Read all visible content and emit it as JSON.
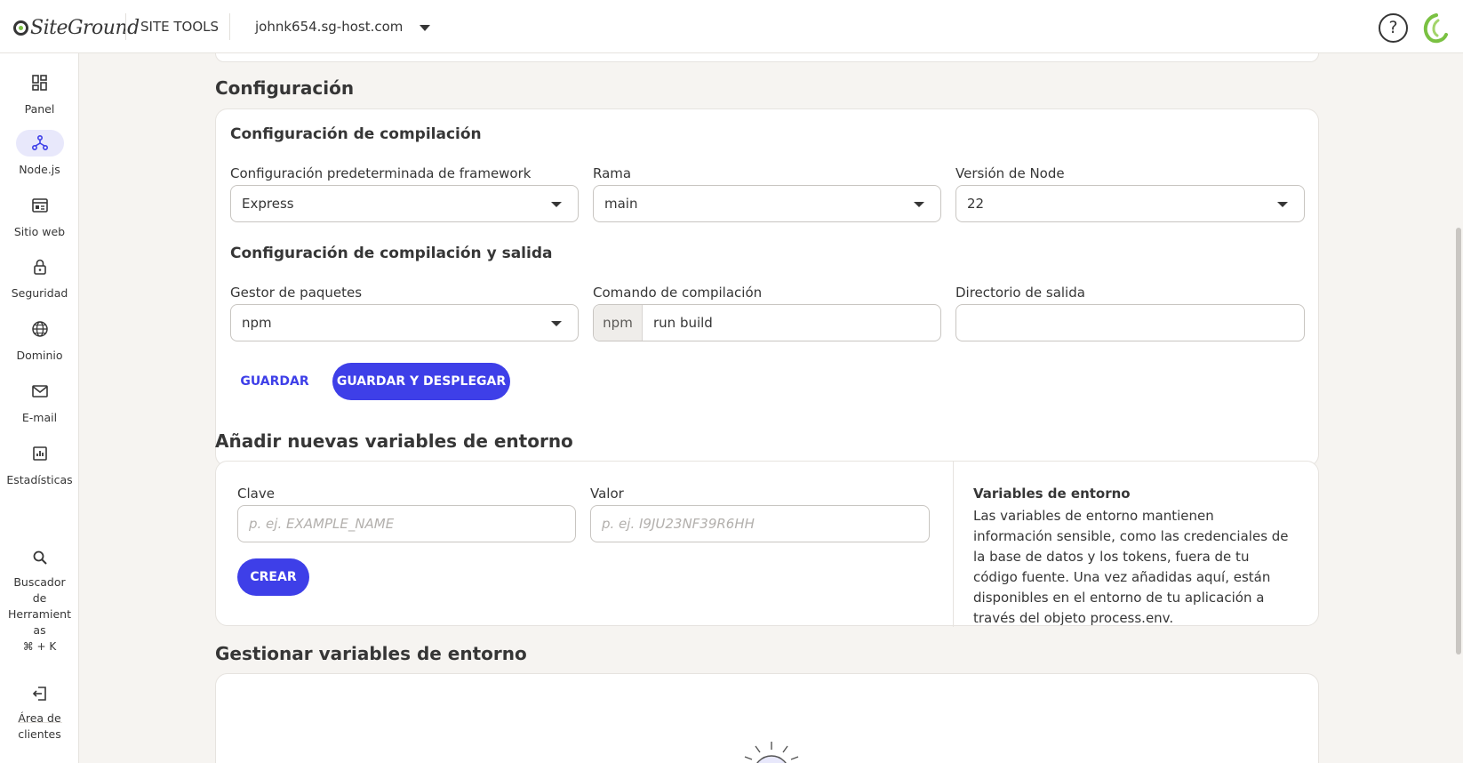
{
  "header": {
    "logo_text": "SiteGround",
    "site_tools_label": "SITE TOOLS",
    "domain": "johnk654.sg-host.com",
    "help_label": "?"
  },
  "sidebar": {
    "items": [
      {
        "label": "Panel",
        "icon": "dashboard-icon"
      },
      {
        "label": "Node.js",
        "icon": "nodejs-icon",
        "active": true
      },
      {
        "label": "Sitio web",
        "icon": "website-icon"
      },
      {
        "label": "Seguridad",
        "icon": "lock-icon"
      },
      {
        "label": "Dominio",
        "icon": "globe-icon"
      },
      {
        "label": "E-mail",
        "icon": "mail-icon"
      },
      {
        "label": "Estadísticas",
        "icon": "chart-icon"
      }
    ],
    "tool_finder": {
      "line1": "Buscador",
      "line2": "de",
      "line3": "Herramient",
      "line4": "as",
      "shortcut": "⌘ + K"
    },
    "client_area": {
      "line1": "Área de",
      "line2": "clientes"
    }
  },
  "config": {
    "section_title": "Configuración",
    "build_title": "Configuración de compilación",
    "framework_label": "Configuración predeterminada de framework",
    "framework_value": "Express",
    "branch_label": "Rama",
    "branch_value": "main",
    "node_label": "Versión de Node",
    "node_value": "22",
    "output_title": "Configuración de compilación y salida",
    "pkg_label": "Gestor de paquetes",
    "pkg_value": "npm",
    "build_cmd_label": "Comando de compilación",
    "build_cmd_prefix": "npm",
    "build_cmd_value": "run build",
    "output_dir_label": "Directorio de salida",
    "output_dir_value": "",
    "save_label": "GUARDAR",
    "save_deploy_label": "GUARDAR Y DESPLEGAR"
  },
  "env_add": {
    "section_title": "Añadir nuevas variables de entorno",
    "key_label": "Clave",
    "key_placeholder": "p. ej. EXAMPLE_NAME",
    "value_label": "Valor",
    "value_placeholder": "p. ej. I9JU23NF39R6HH",
    "create_label": "CREAR",
    "info_title": "Variables de entorno",
    "info_text": "Las variables de entorno mantienen información sensible, como las credenciales de la base de datos y los tokens, fuera de tu código fuente. Una vez añadidas aquí, están disponibles en el entorno de tu aplicación a través del objeto process.env."
  },
  "env_manage": {
    "section_title": "Gestionar variables de entorno"
  },
  "colors": {
    "accent": "#3e3fe8",
    "brand_green": "#7ac142",
    "background": "#f6f4f1"
  }
}
